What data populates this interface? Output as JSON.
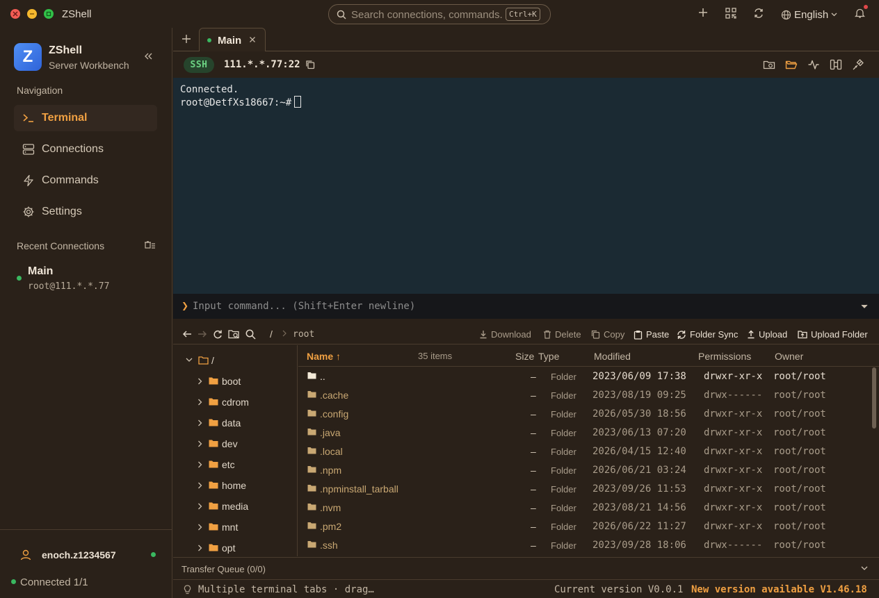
{
  "window": {
    "title": "ZShell"
  },
  "search": {
    "placeholder": "Search connections, commands...",
    "shortcut": "Ctrl+K"
  },
  "titlebar": {
    "language": "English"
  },
  "sidebar": {
    "brand_name": "ZShell",
    "brand_subtitle": "Server Workbench",
    "nav_label": "Navigation",
    "nav_items": [
      {
        "label": "Terminal",
        "icon": "terminal-icon",
        "active": true
      },
      {
        "label": "Connections",
        "icon": "server-icon",
        "active": false
      },
      {
        "label": "Commands",
        "icon": "lightning-icon",
        "active": false
      },
      {
        "label": "Settings",
        "icon": "gear-icon",
        "active": false
      }
    ],
    "recent_label": "Recent Connections",
    "recent": [
      {
        "name": "Main",
        "host": "root@111.*.*.77"
      }
    ],
    "user": "enoch.z1234567",
    "connection_status": "Connected 1/1"
  },
  "tabs": [
    {
      "label": "Main"
    }
  ],
  "connection": {
    "protocol": "SSH",
    "host": "111.*.*.77:22"
  },
  "terminal": {
    "lines": [
      "Connected.",
      "root@DetfXs18667:~#"
    ]
  },
  "command_input": {
    "prompt": "❯",
    "placeholder": "Input command... (Shift+Enter newline)"
  },
  "file_manager": {
    "path_root": "/",
    "path_current": "root",
    "actions": {
      "download": "Download",
      "delete": "Delete",
      "copy": "Copy",
      "paste": "Paste",
      "folder_sync": "Folder Sync",
      "upload": "Upload",
      "upload_folder": "Upload Folder"
    },
    "tree_root": "/",
    "tree": [
      "boot",
      "cdrom",
      "data",
      "dev",
      "etc",
      "home",
      "media",
      "mnt",
      "opt"
    ],
    "columns": {
      "name": "Name",
      "count": "35 items",
      "size": "Size",
      "type": "Type",
      "modified": "Modified",
      "permissions": "Permissions",
      "owner": "Owner"
    },
    "rows": [
      {
        "name": "..",
        "size": "–",
        "type": "Folder",
        "modified": "2023/06/09 17:38",
        "permissions": "drwxr-xr-x",
        "owner": "root/root"
      },
      {
        "name": ".cache",
        "size": "–",
        "type": "Folder",
        "modified": "2023/08/19 09:25",
        "permissions": "drwx------",
        "owner": "root/root"
      },
      {
        "name": ".config",
        "size": "–",
        "type": "Folder",
        "modified": "2026/05/30 18:56",
        "permissions": "drwxr-xr-x",
        "owner": "root/root"
      },
      {
        "name": ".java",
        "size": "–",
        "type": "Folder",
        "modified": "2023/06/13 07:20",
        "permissions": "drwxr-xr-x",
        "owner": "root/root"
      },
      {
        "name": ".local",
        "size": "–",
        "type": "Folder",
        "modified": "2026/04/15 12:40",
        "permissions": "drwxr-xr-x",
        "owner": "root/root"
      },
      {
        "name": ".npm",
        "size": "–",
        "type": "Folder",
        "modified": "2026/06/21 03:24",
        "permissions": "drwxr-xr-x",
        "owner": "root/root"
      },
      {
        "name": ".npminstall_tarball",
        "size": "–",
        "type": "Folder",
        "modified": "2023/09/26 11:53",
        "permissions": "drwxr-xr-x",
        "owner": "root/root"
      },
      {
        "name": ".nvm",
        "size": "–",
        "type": "Folder",
        "modified": "2023/08/21 14:56",
        "permissions": "drwxr-xr-x",
        "owner": "root/root"
      },
      {
        "name": ".pm2",
        "size": "–",
        "type": "Folder",
        "modified": "2026/06/22 11:27",
        "permissions": "drwxr-xr-x",
        "owner": "root/root"
      },
      {
        "name": ".ssh",
        "size": "–",
        "type": "Folder",
        "modified": "2023/09/28 18:06",
        "permissions": "drwx------",
        "owner": "root/root"
      }
    ]
  },
  "transfer": {
    "label": "Transfer Queue (0/0)"
  },
  "status": {
    "tip": "Multiple terminal tabs · drag…",
    "version": "Current version V0.0.1",
    "new_version": "New version available V1.46.18"
  },
  "colors": {
    "accent": "#f0a042",
    "online": "#3ab860",
    "terminal_bg": "#1b2a33",
    "app_bg": "#2a2119"
  }
}
